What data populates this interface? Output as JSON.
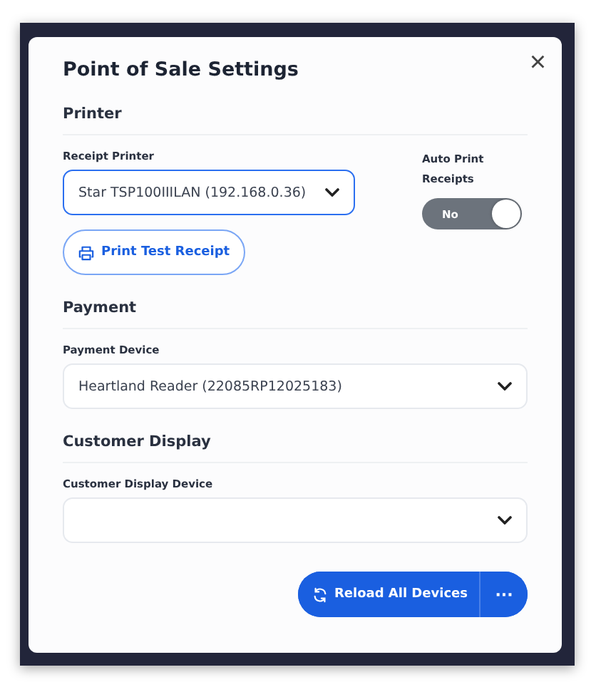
{
  "dialog": {
    "title": "Point of Sale Settings",
    "close": "×"
  },
  "sections": [
    {
      "heading": "Printer",
      "fields": [
        {
          "kind": "select",
          "label": "Receipt Printer",
          "value": "Star TSP100IIILAN (192.168.0.36)",
          "focused": true
        },
        {
          "kind": "toggle",
          "label": "Auto Print Receipts",
          "value": "No",
          "on": false
        }
      ],
      "button": {
        "label": "Print Test Receipt"
      }
    },
    {
      "heading": "Payment",
      "fields": [
        {
          "kind": "select",
          "label": "Payment Device",
          "value": "Heartland Reader (22085RP12025183)",
          "focused": false
        }
      ]
    },
    {
      "heading": "Customer Display",
      "fields": [
        {
          "kind": "select",
          "label": "Customer Display Device",
          "focused": false
        }
      ]
    }
  ],
  "footer": {
    "button": "Reload All Devices",
    "more": "···"
  }
}
